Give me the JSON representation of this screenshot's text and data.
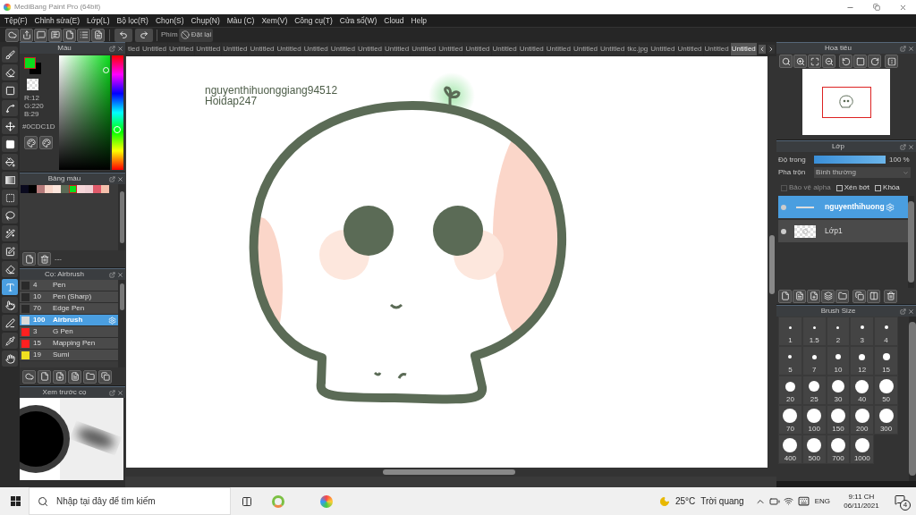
{
  "window": {
    "title": "MediBang Paint Pro (64bit)"
  },
  "menu": [
    "Tệp(F)",
    "Chỉnh sửa(E)",
    "Lớp(L)",
    "Bộ lọc(R)",
    "Chọn(S)",
    "Chụp(N)",
    "Màu (C)",
    "Xem(V)",
    "Công cụ(T)",
    "Cửa sổ(W)",
    "Cloud",
    "Help"
  ],
  "toolbar": {
    "shortcut_label": "Phím",
    "reset_button": "Đặt lại"
  },
  "tabs": [
    {
      "label": "tled",
      "selected": false
    },
    {
      "label": "Untitled",
      "selected": false
    },
    {
      "label": "Untitled",
      "selected": false
    },
    {
      "label": "Untitled",
      "selected": false
    },
    {
      "label": "Untitled",
      "selected": false
    },
    {
      "label": "Untitled",
      "selected": false
    },
    {
      "label": "Untitled",
      "selected": false
    },
    {
      "label": "Untitled",
      "selected": false
    },
    {
      "label": "Untitled",
      "selected": false
    },
    {
      "label": "Untitled",
      "selected": false
    },
    {
      "label": "Untitled",
      "selected": false
    },
    {
      "label": "Untitled",
      "selected": false
    },
    {
      "label": "Untitled",
      "selected": false
    },
    {
      "label": "Untitled",
      "selected": false
    },
    {
      "label": "Untitled",
      "selected": false
    },
    {
      "label": "Untitled",
      "selected": false
    },
    {
      "label": "Untitled",
      "selected": false
    },
    {
      "label": "Untitled",
      "selected": false
    },
    {
      "label": "Untitled",
      "selected": false
    },
    {
      "label": "tkc.jpg",
      "selected": false
    },
    {
      "label": "Untitled",
      "selected": false
    },
    {
      "label": "Untitled",
      "selected": false
    },
    {
      "label": "Untitled",
      "selected": false
    },
    {
      "label": "Untitled",
      "selected": true
    }
  ],
  "tools": [
    {
      "kind": "brush",
      "selected": false
    },
    {
      "kind": "eraser",
      "selected": false
    },
    {
      "kind": "dot",
      "selected": false
    },
    {
      "kind": "curve",
      "selected": false
    },
    {
      "kind": "move",
      "selected": false
    },
    {
      "kind": "fill",
      "selected": false
    },
    {
      "kind": "bucket",
      "selected": false
    },
    {
      "kind": "gradient",
      "selected": false
    },
    {
      "kind": "select",
      "selected": false
    },
    {
      "kind": "lasso",
      "selected": false
    },
    {
      "kind": "wand",
      "selected": false
    },
    {
      "kind": "select-pen",
      "selected": false
    },
    {
      "kind": "select-eraser",
      "selected": false
    },
    {
      "kind": "text",
      "selected": true
    },
    {
      "kind": "operation",
      "selected": false
    },
    {
      "kind": "divide",
      "selected": false
    },
    {
      "kind": "eyedropper",
      "selected": false
    },
    {
      "kind": "hand",
      "selected": false
    }
  ],
  "color_panel": {
    "title": "Màu",
    "rgb": [
      "R:12",
      "G:220",
      "B:29"
    ],
    "hex": "#0CDC1D"
  },
  "palette": {
    "title": "Bảng màu",
    "footer": "---",
    "swatches": [
      {
        "color": "#0a0a1e",
        "selected": false
      },
      {
        "color": "#000000",
        "selected": false
      },
      {
        "color": "#b57a7a",
        "selected": false
      },
      {
        "color": "#f8d5c8",
        "selected": false
      },
      {
        "color": "#fbe5dc",
        "selected": false
      },
      {
        "color": "#5b6b56",
        "selected": false
      },
      {
        "color": "#0cdc1d",
        "selected": true
      },
      {
        "color": "#f6d6d8",
        "selected": false
      },
      {
        "color": "#f0d0d4",
        "selected": false
      },
      {
        "color": "#e05a6a",
        "selected": false
      },
      {
        "color": "#f5c0ac",
        "selected": false
      }
    ]
  },
  "brushes": {
    "title": "Cọ: Airbrush",
    "items": [
      {
        "size": "4",
        "name": "Pen",
        "color": "#2a2a2a",
        "selected": false
      },
      {
        "size": "10",
        "name": "Pen (Sharp)",
        "color": "#2a2a2a",
        "selected": false
      },
      {
        "size": "70",
        "name": "Edge Pen",
        "color": "#2a2a2a",
        "selected": false
      },
      {
        "size": "100",
        "name": "Airbrush",
        "color": "#d9d9d9",
        "selected": true
      },
      {
        "size": "3",
        "name": "G Pen",
        "color": "#ff2020",
        "selected": false
      },
      {
        "size": "15",
        "name": "Mapping Pen",
        "color": "#ff2020",
        "selected": false
      },
      {
        "size": "19",
        "name": "Sumi",
        "color": "#f0e020",
        "selected": false
      }
    ]
  },
  "preview": {
    "title": "Xem trước cọ"
  },
  "navigator": {
    "title": "Hoa tiêu"
  },
  "layers": {
    "title": "Lớp",
    "opacity_label": "Độ trong",
    "opacity": {
      "level": 1
    },
    "opacity_reading": "100 %",
    "blend_label": "Pha trộn",
    "blend_value": "Bình thường",
    "options": [
      {
        "label": "Bảo vệ alpha",
        "checked": false,
        "disabled": true
      },
      {
        "label": "Xén bớt",
        "checked": false,
        "disabled": false
      },
      {
        "label": "Khóa",
        "checked": false,
        "disabled": false
      }
    ],
    "items": [
      {
        "name": "nguyenthihuong",
        "selected": true
      },
      {
        "name": "Lớp1",
        "selected": false
      }
    ]
  },
  "brush_size": {
    "title": "Brush Size",
    "sizes": [
      "1",
      "1.5",
      "2",
      "3",
      "4",
      "5",
      "7",
      "10",
      "12",
      "15",
      "20",
      "25",
      "30",
      "40",
      "50",
      "70",
      "100",
      "150",
      "200",
      "300",
      "400",
      "500",
      "700",
      "1000"
    ]
  },
  "canvas": {
    "texts": [
      "nguyenthihuonggiang94512",
      "Hoidap247"
    ]
  },
  "taskbar": {
    "search_placeholder": "Nhập tại đây để tìm kiếm",
    "temperature": "25°C",
    "weather": "Trời quang",
    "language": "ENG",
    "time": "9:11 CH",
    "date": "06/11/2021",
    "notifications": "4"
  }
}
